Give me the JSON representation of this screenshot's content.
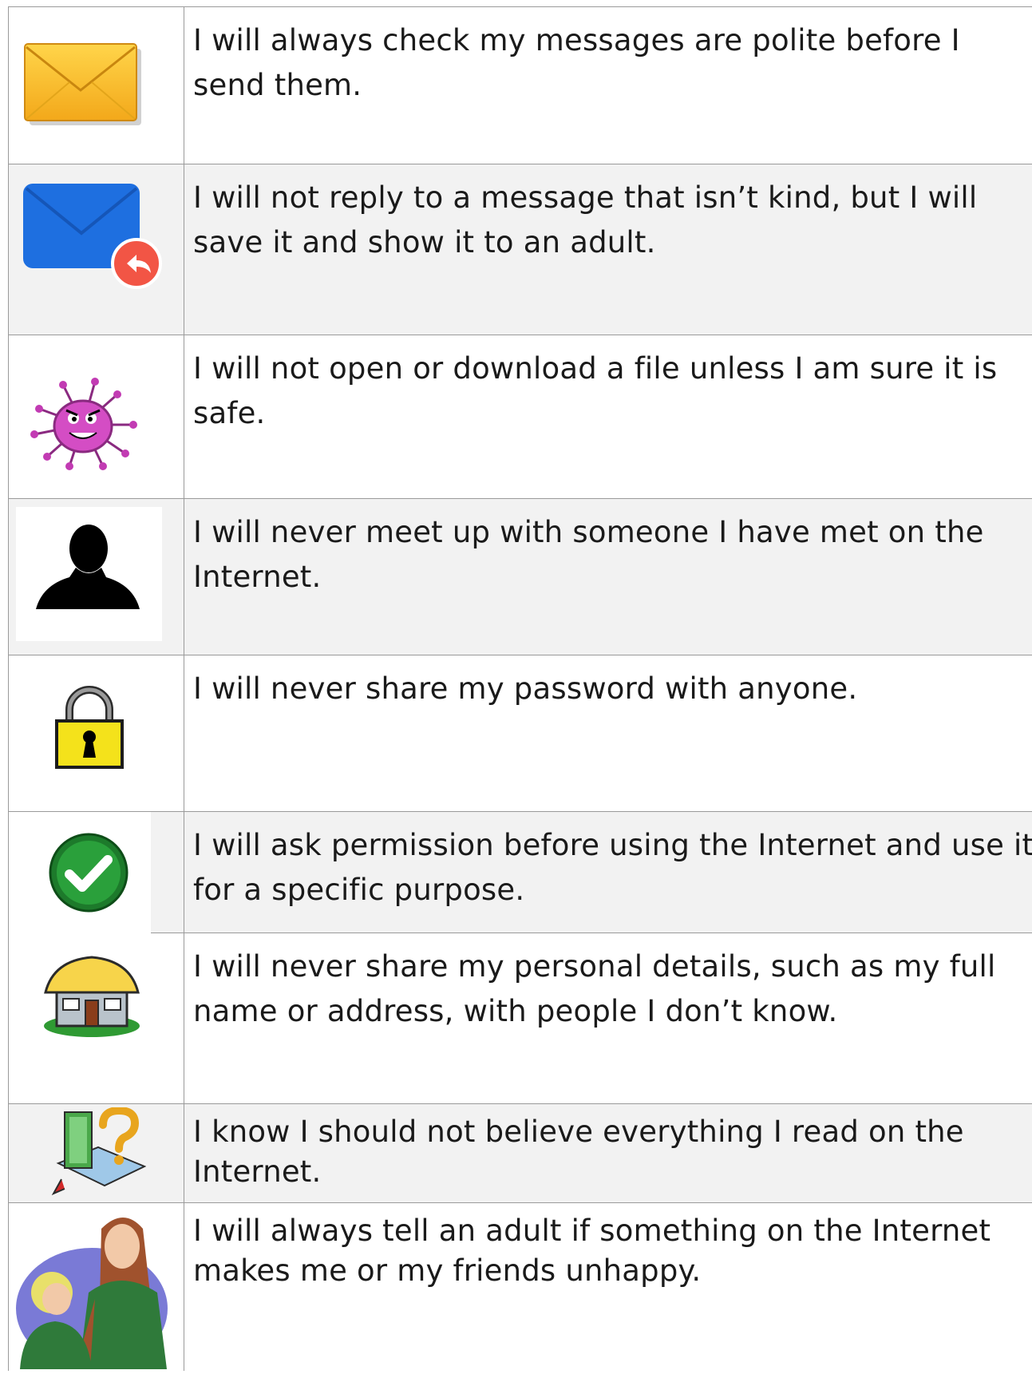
{
  "rules": [
    {
      "icon": "envelope-icon",
      "text": "I will always check my messages are polite before I send them."
    },
    {
      "icon": "reply-mail-icon",
      "text": "I will not reply to a message that isn’t kind, but I will save it and show it to an adult."
    },
    {
      "icon": "virus-icon",
      "text": "I will not open or download a file unless I am sure it is safe."
    },
    {
      "icon": "stranger-silhouette-icon",
      "text": "I will never meet up with someone I have met on the Internet."
    },
    {
      "icon": "padlock-icon",
      "text": "I will never share my password with anyone."
    },
    {
      "icon": "checkmark-icon",
      "text": "I will ask permission before using the Internet and use it for a specific purpose."
    },
    {
      "icon": "house-icon",
      "text": "I will never share my personal details, such as my full name or address, with people I don’t know."
    },
    {
      "icon": "book-question-icon",
      "text": "I know I should not believe everything I read on the Internet."
    },
    {
      "icon": "adult-child-icon",
      "text": "I will always tell an adult if something on the Internet makes me or my friends unhappy."
    }
  ]
}
